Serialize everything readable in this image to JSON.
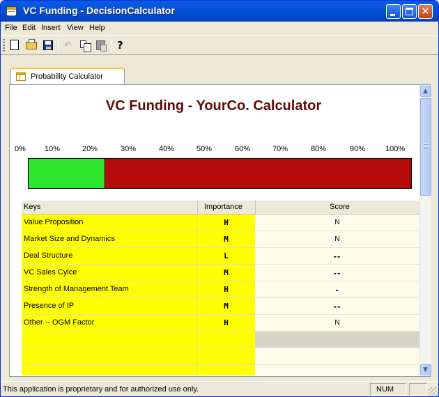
{
  "window": {
    "title": "VC Funding - DecisionCalculator"
  },
  "menu": [
    {
      "label": "File"
    },
    {
      "label": "Edit"
    },
    {
      "label": "Insert"
    },
    {
      "label": "View"
    },
    {
      "label": "Help"
    }
  ],
  "toolbar": {
    "icons": [
      "new-icon",
      "open-icon",
      "save-icon",
      "undo-icon",
      "copy-icon",
      "paste-icon",
      "help-icon"
    ],
    "help_glyph": "?"
  },
  "tab": {
    "label": "Probability Calculator"
  },
  "calculator": {
    "title": "VC Funding - YourCo. Calculator",
    "scale_labels": [
      "0%",
      "10%",
      "20%",
      "30%",
      "40%",
      "50%",
      "60%",
      "70%",
      "80%",
      "90%",
      "100%"
    ],
    "probability_fraction": 0.2,
    "colors": {
      "probability_fill": "#2ee62e",
      "bar_background": "#b50a0a",
      "key_cell": "#ffff00",
      "title": "#600a0a"
    }
  },
  "grid": {
    "headers": {
      "keys": "Keys",
      "importance": "Importance",
      "score": "Score"
    },
    "rows": [
      {
        "key": "Value Proposition",
        "importance": "H",
        "score": "N"
      },
      {
        "key": "Market Size and Dynamics",
        "importance": "M",
        "score": "N"
      },
      {
        "key": "Deal Structure",
        "importance": "L",
        "score": "--"
      },
      {
        "key": "VC Sales Cylce",
        "importance": "M",
        "score": "--"
      },
      {
        "key": "Strength of Management Team",
        "importance": "H",
        "score": "-"
      },
      {
        "key": "Presence of IP",
        "importance": "M",
        "score": "--"
      },
      {
        "key": "Other -- OGM Factor",
        "importance": "H",
        "score": "N"
      }
    ]
  },
  "statusbar": {
    "message": "This application is proprietary and for authorized use only.",
    "num": "NUM"
  },
  "titlebar_buttons": {
    "close_glyph": "✕"
  }
}
